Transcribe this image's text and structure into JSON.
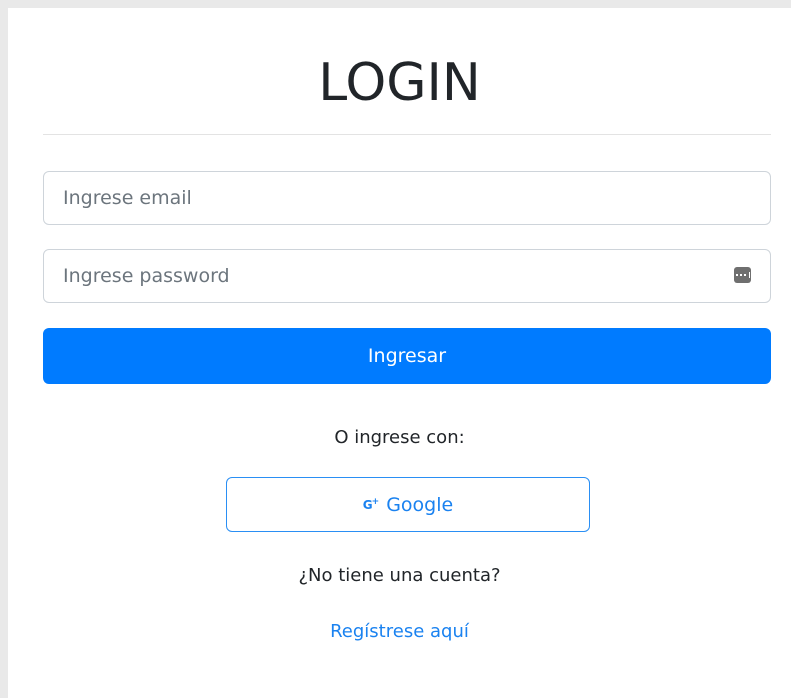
{
  "login": {
    "title": "LOGIN",
    "email_placeholder": "Ingrese email",
    "password_placeholder": "Ingrese password",
    "submit_label": "Ingresar",
    "alt_login_text": "O ingrese con:",
    "google_label": "Google",
    "no_account_text": "¿No tiene una cuenta?",
    "register_label": "Regístrese aquí"
  },
  "icons": {
    "google": "google-plus-icon",
    "password_manager": "password-key-icon"
  },
  "colors": {
    "primary": "#007bff",
    "link": "#1a82f0",
    "text": "#212529",
    "placeholder": "#6c757d"
  }
}
